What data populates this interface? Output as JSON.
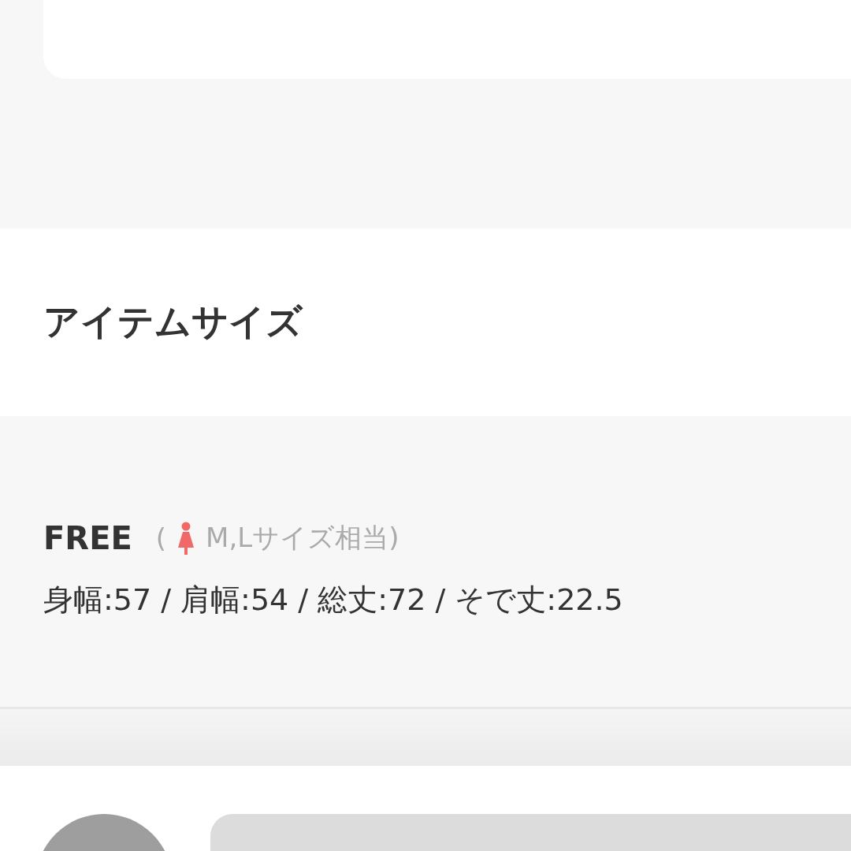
{
  "section_title": "アイテムサイズ",
  "sizes": [
    {
      "label": "FREE",
      "note_open": "(",
      "note": "M,Lサイズ相当)",
      "measurements": "身幅:57 / 肩幅:54 / 総丈:72 / そで丈:22.5"
    }
  ]
}
